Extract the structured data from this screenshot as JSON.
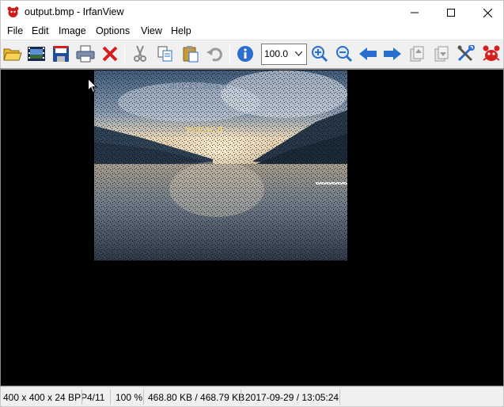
{
  "window": {
    "title": "output.bmp - IrfanView",
    "min_icon": "minimize-icon",
    "max_icon": "maximize-icon",
    "close_icon": "close-icon"
  },
  "menu": [
    {
      "label": "File"
    },
    {
      "label": "Edit"
    },
    {
      "label": "Image"
    },
    {
      "label": "Options"
    },
    {
      "label": "View"
    },
    {
      "label": "Help"
    }
  ],
  "toolbar": {
    "zoom_value": "100.0",
    "icons": [
      "open-folder-icon",
      "slideshow-icon",
      "save-icon",
      "print-icon",
      "delete-icon",
      "cut-icon",
      "copy-icon",
      "paste-icon",
      "undo-icon",
      "info-icon",
      "zoom-in-icon",
      "zoom-out-icon",
      "previous-icon",
      "next-icon",
      "first-icon",
      "last-icon",
      "settings-icon",
      "irfanview-logo-icon"
    ]
  },
  "image": {
    "caption_top": "POCZTÓWKA",
    "caption_mid": "WAKACJI"
  },
  "status": {
    "dimensions": "400 x 400 x 24 BPP",
    "index": "4/11",
    "zoom": "100 %",
    "size": "468.80 KB / 468.79 KB",
    "datetime": "2017-09-29 / 13:05:24"
  },
  "colors": {
    "viewer_bg": "#000000",
    "accent_blue": "#2a6fd0",
    "red": "#d42020"
  }
}
